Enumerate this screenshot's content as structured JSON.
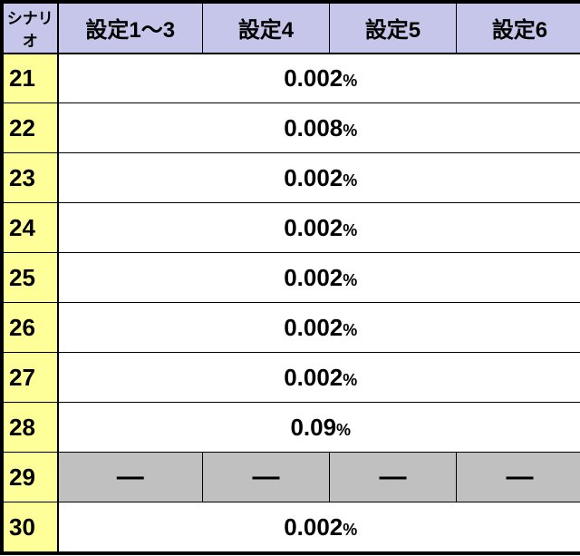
{
  "chart_data": {
    "type": "table",
    "title": "",
    "columns": [
      "シナリオ",
      "設定1〜3",
      "設定4",
      "設定5",
      "設定6"
    ],
    "rows": [
      {
        "scenario": "21",
        "values": [
          "0.002%",
          "0.002%",
          "0.002%",
          "0.002%"
        ],
        "merged": true
      },
      {
        "scenario": "22",
        "values": [
          "0.008%",
          "0.008%",
          "0.008%",
          "0.008%"
        ],
        "merged": true
      },
      {
        "scenario": "23",
        "values": [
          "0.002%",
          "0.002%",
          "0.002%",
          "0.002%"
        ],
        "merged": true
      },
      {
        "scenario": "24",
        "values": [
          "0.002%",
          "0.002%",
          "0.002%",
          "0.002%"
        ],
        "merged": true
      },
      {
        "scenario": "25",
        "values": [
          "0.002%",
          "0.002%",
          "0.002%",
          "0.002%"
        ],
        "merged": true
      },
      {
        "scenario": "26",
        "values": [
          "0.002%",
          "0.002%",
          "0.002%",
          "0.002%"
        ],
        "merged": true
      },
      {
        "scenario": "27",
        "values": [
          "0.002%",
          "0.002%",
          "0.002%",
          "0.002%"
        ],
        "merged": true
      },
      {
        "scenario": "28",
        "values": [
          "0.09%",
          "0.09%",
          "0.09%",
          "0.09%"
        ],
        "merged": true
      },
      {
        "scenario": "29",
        "values": [
          "—",
          "—",
          "—",
          "—"
        ],
        "merged": false,
        "dash": true
      },
      {
        "scenario": "30",
        "values": [
          "0.002%",
          "0.002%",
          "0.002%",
          "0.002%"
        ],
        "merged": true
      }
    ]
  },
  "header": {
    "corner": "シナリオ",
    "cols": [
      "設定1〜3",
      "設定4",
      "設定5",
      "設定6"
    ]
  },
  "rows": [
    {
      "h": "21",
      "merged": "0.002",
      "pct": "%"
    },
    {
      "h": "22",
      "merged": "0.008",
      "pct": "%"
    },
    {
      "h": "23",
      "merged": "0.002",
      "pct": "%"
    },
    {
      "h": "24",
      "merged": "0.002",
      "pct": "%"
    },
    {
      "h": "25",
      "merged": "0.002",
      "pct": "%"
    },
    {
      "h": "26",
      "merged": "0.002",
      "pct": "%"
    },
    {
      "h": "27",
      "merged": "0.002",
      "pct": "%"
    },
    {
      "h": "28",
      "merged": "0.09",
      "pct": "%"
    },
    {
      "h": "29",
      "cells": [
        "—",
        "—",
        "—",
        "—"
      ]
    },
    {
      "h": "30",
      "merged": "0.002",
      "pct": "%"
    }
  ]
}
